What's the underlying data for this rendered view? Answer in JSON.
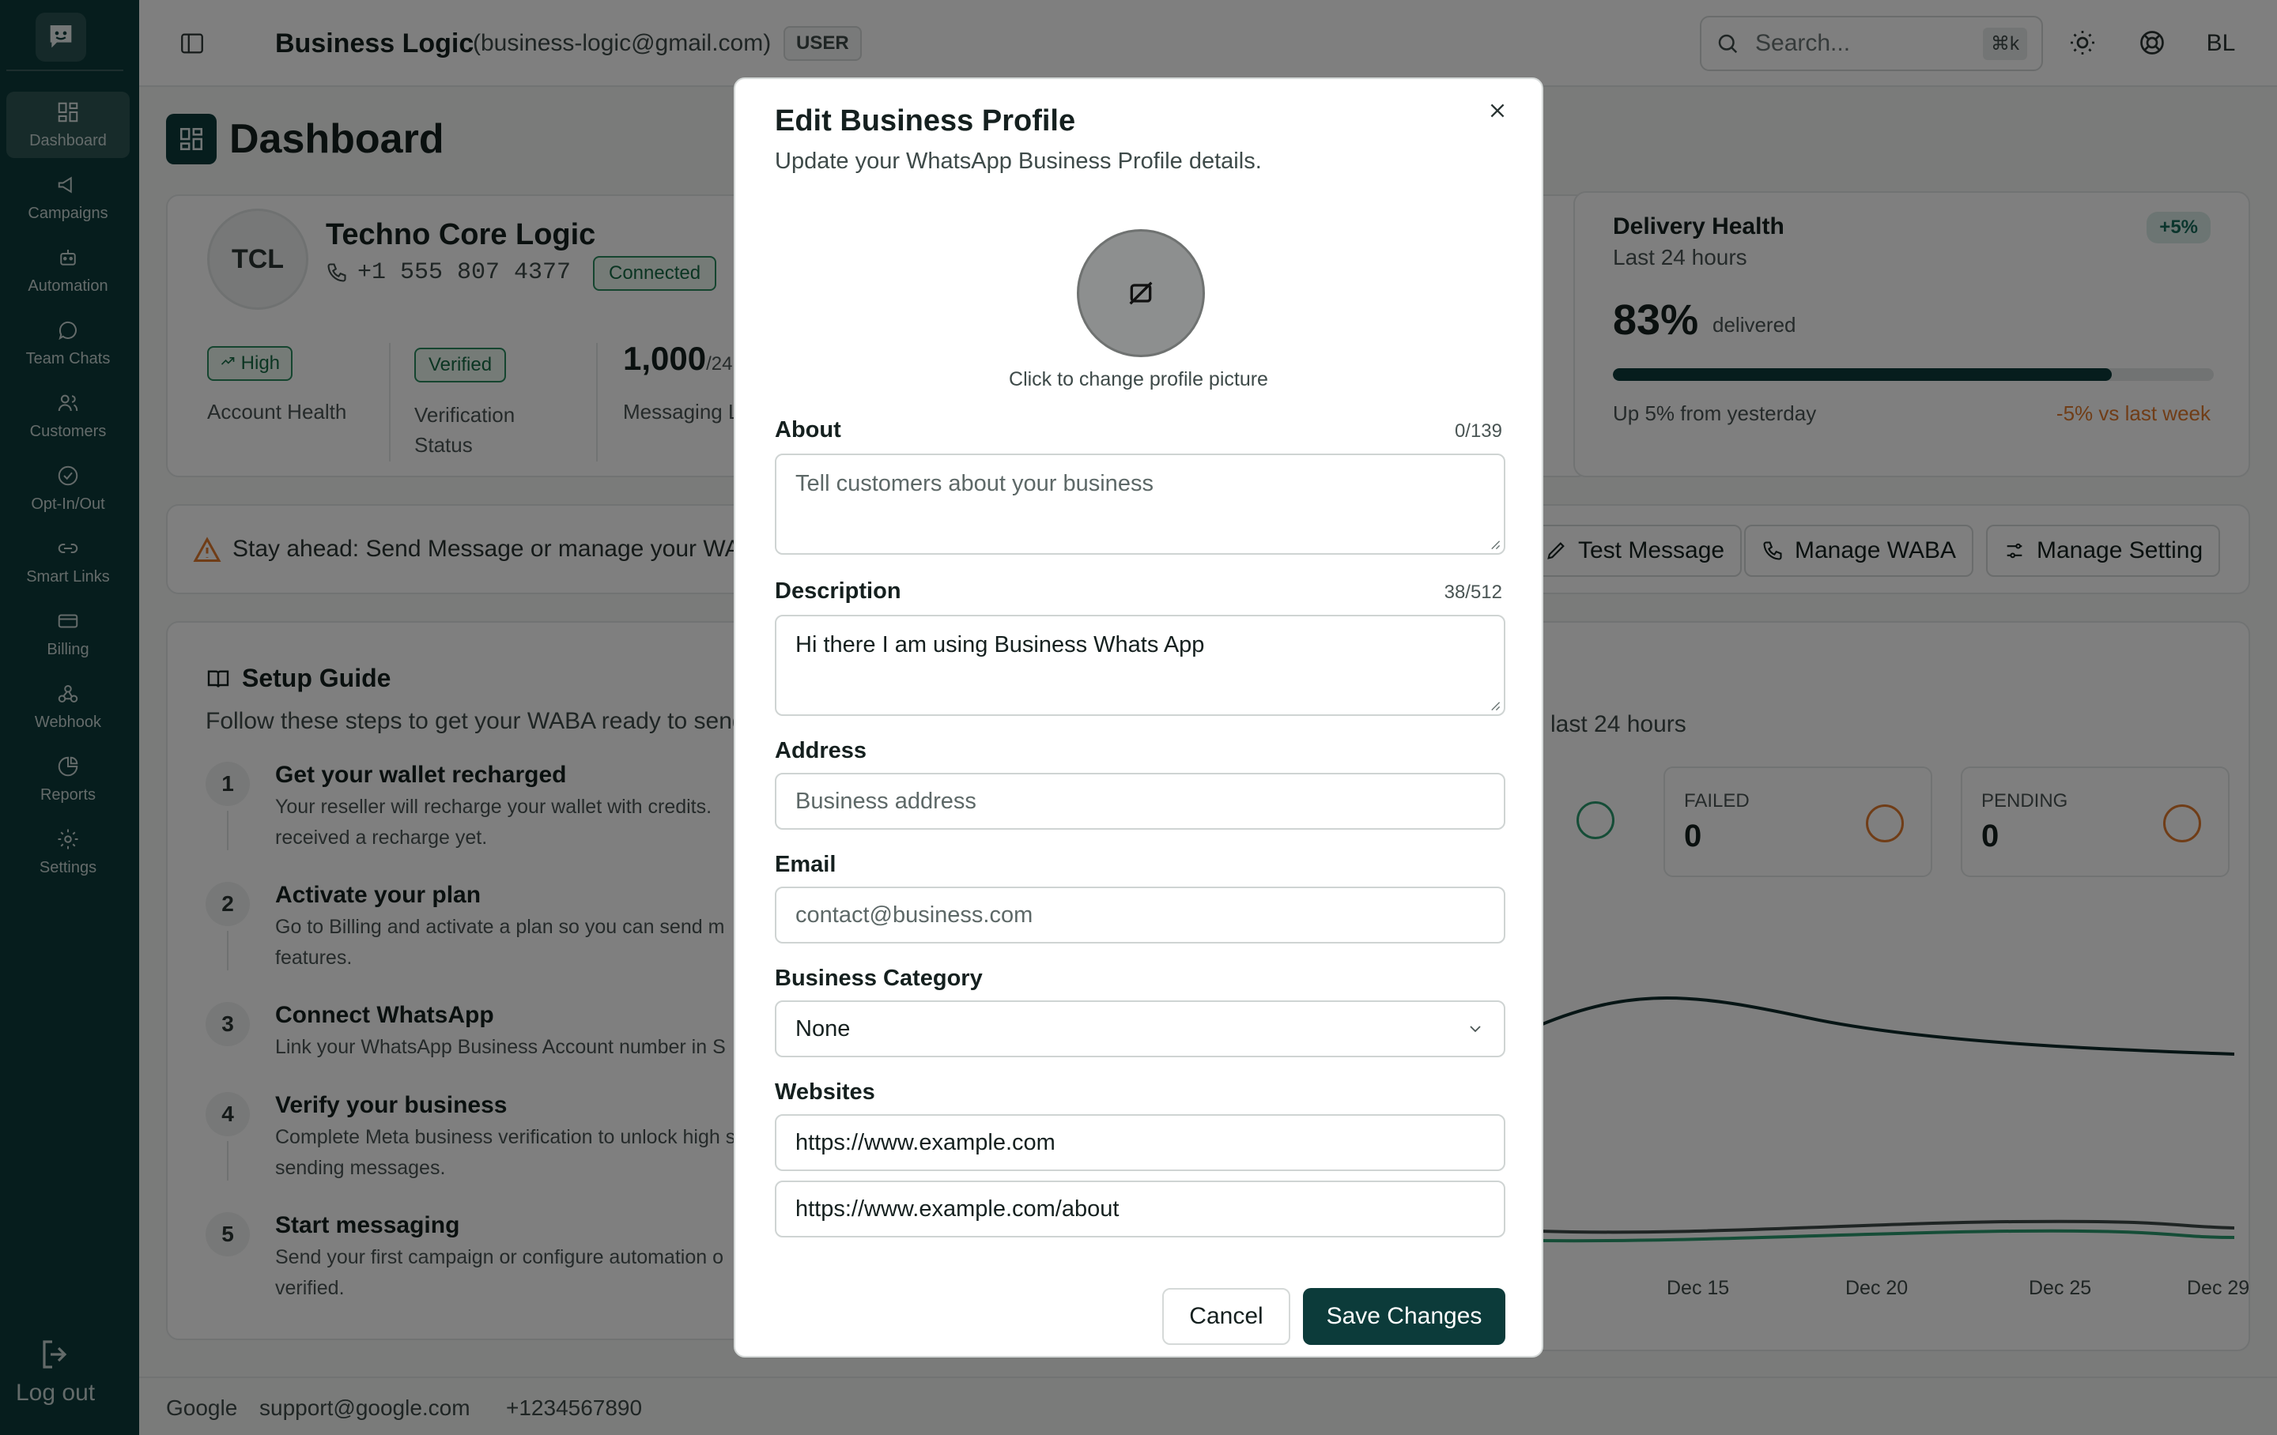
{
  "sidebar": {
    "items": [
      {
        "label": "Dashboard",
        "icon": "dashboard-icon",
        "active": true
      },
      {
        "label": "Campaigns",
        "icon": "megaphone-icon"
      },
      {
        "label": "Automation",
        "icon": "bot-icon"
      },
      {
        "label": "Team Chats",
        "icon": "chat-icon"
      },
      {
        "label": "Customers",
        "icon": "users-icon"
      },
      {
        "label": "Opt-In/Out",
        "icon": "check-circle-icon"
      },
      {
        "label": "Smart Links",
        "icon": "link-icon"
      },
      {
        "label": "Billing",
        "icon": "card-icon"
      },
      {
        "label": "Webhook",
        "icon": "webhook-icon"
      },
      {
        "label": "Reports",
        "icon": "pie-chart-icon"
      },
      {
        "label": "Settings",
        "icon": "gear-icon"
      }
    ],
    "logout_label": "Log out"
  },
  "header": {
    "title": "Business Logic",
    "email": "(business-logic@gmail.com)",
    "role": "USER",
    "search_placeholder": "Search...",
    "shortcut": "⌘k",
    "avatar_initials": "BL"
  },
  "main": {
    "page_title": "Dashboard",
    "business": {
      "initials": "TCL",
      "name": "Techno Core Logic",
      "phone": "+1 555 807 4377",
      "status": "Connected",
      "health_badge": "High",
      "health_label": "Account Health",
      "verification_badge": "Verified",
      "verification_label": "Verification Status",
      "messaging_value": "1,000",
      "messaging_suffix": "/24",
      "messaging_label": "Messaging L"
    },
    "delivery": {
      "title": "Delivery Health",
      "subtitle": "Last 24 hours",
      "badge": "+5%",
      "percent": "83%",
      "percent_label": "delivered",
      "fill_fraction": 0.83,
      "up_text": "Up 5% from yesterday",
      "down_text": "-5% vs last week"
    },
    "alert_text": "Stay ahead: Send Message or manage your WAB",
    "actions": {
      "test_message": "Test Message",
      "manage_waba": "Manage WABA",
      "manage_setting": "Manage Setting"
    },
    "setup": {
      "title": "Setup Guide",
      "subtitle": "Follow these steps to get your WABA ready to send",
      "steps": [
        {
          "num": "1",
          "title": "Get your wallet recharged",
          "desc": "Your reseller will recharge your wallet with credits. received a recharge yet."
        },
        {
          "num": "2",
          "title": "Activate your plan",
          "desc": "Go to Billing and activate a plan so you can send m features."
        },
        {
          "num": "3",
          "title": "Connect WhatsApp",
          "desc": "Link your WhatsApp Business Account number in S"
        },
        {
          "num": "4",
          "title": "Verify your business",
          "desc": "Complete Meta business verification to unlock high start sending messages."
        },
        {
          "num": "5",
          "title": "Start messaging",
          "desc": "Send your first campaign or configure automation o verified."
        }
      ]
    },
    "stats_subtitle": "e last 24 hours",
    "stats": {
      "failed_label": "FAILED",
      "failed_value": "0",
      "pending_label": "PENDING",
      "pending_value": "0"
    },
    "x_ticks": [
      "Dec 15",
      "Dec 20",
      "Dec 25",
      "Dec 29"
    ]
  },
  "footer": {
    "company": "Google",
    "email": "support@google.com",
    "phone": "+1234567890"
  },
  "modal": {
    "title": "Edit Business Profile",
    "subtitle": "Update your WhatsApp Business Profile details.",
    "picture_caption": "Click to change profile picture",
    "about_label": "About",
    "about_count": "0/139",
    "about_placeholder": "Tell customers about your business",
    "description_label": "Description",
    "description_count": "38/512",
    "description_value": "Hi there I am using Business Whats App",
    "address_label": "Address",
    "address_placeholder": "Business address",
    "email_label": "Email",
    "email_placeholder": "contact@business.com",
    "category_label": "Business Category",
    "category_value": "None",
    "websites_label": "Websites",
    "website_1": "https://www.example.com",
    "website_2": "https://www.example.com/about",
    "cancel_label": "Cancel",
    "save_label": "Save Changes"
  }
}
